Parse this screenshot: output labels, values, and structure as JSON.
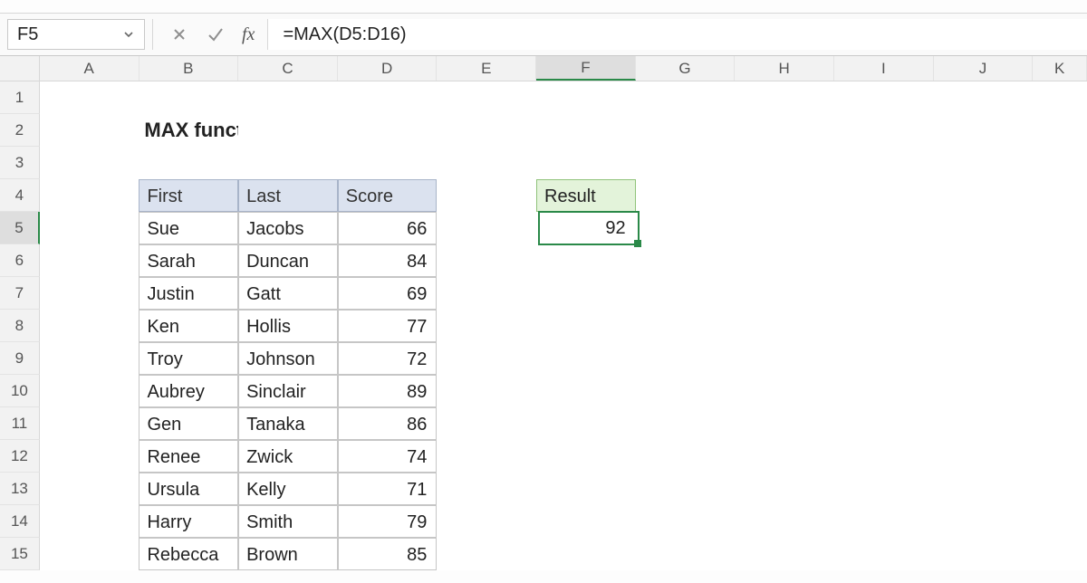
{
  "namebox": {
    "value": "F5"
  },
  "formula": {
    "value": "=MAX(D5:D16)"
  },
  "columns": [
    "A",
    "B",
    "C",
    "D",
    "E",
    "F",
    "G",
    "H",
    "I",
    "J",
    "K"
  ],
  "row_numbers": [
    1,
    2,
    3,
    4,
    5,
    6,
    7,
    8,
    9,
    10,
    11,
    12,
    13,
    14,
    15
  ],
  "title": "MAX function",
  "headers": {
    "first": "First",
    "last": "Last",
    "score": "Score",
    "result": "Result"
  },
  "data_rows": [
    {
      "first": "Sue",
      "last": "Jacobs",
      "score": 66
    },
    {
      "first": "Sarah",
      "last": "Duncan",
      "score": 84
    },
    {
      "first": "Justin",
      "last": "Gatt",
      "score": 69
    },
    {
      "first": "Ken",
      "last": "Hollis",
      "score": 77
    },
    {
      "first": "Troy",
      "last": "Johnson",
      "score": 72
    },
    {
      "first": "Aubrey",
      "last": "Sinclair",
      "score": 89
    },
    {
      "first": "Gen",
      "last": "Tanaka",
      "score": 86
    },
    {
      "first": "Renee",
      "last": "Zwick",
      "score": 74
    },
    {
      "first": "Ursula",
      "last": "Kelly",
      "score": 71
    },
    {
      "first": "Harry",
      "last": "Smith",
      "score": 79
    },
    {
      "first": "Rebecca",
      "last": "Brown",
      "score": 85
    }
  ],
  "result_value": 92,
  "selected_column": "F",
  "selected_row": 5
}
